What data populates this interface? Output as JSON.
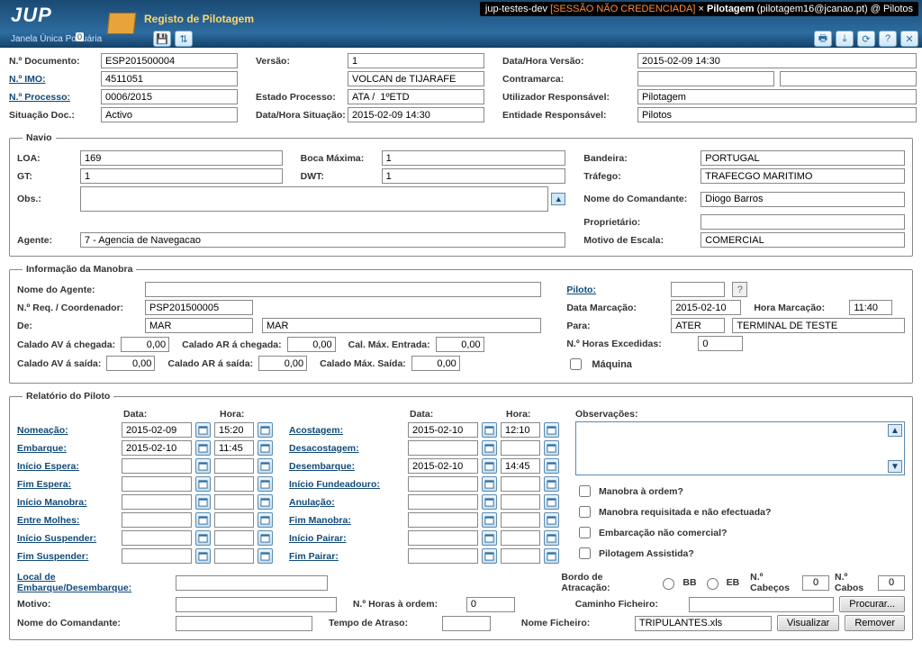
{
  "app": {
    "logo_text": "JUP",
    "subtitle": "Janela Única Portuária",
    "badge": "0",
    "module_title": "Registo de Pilotagem",
    "envbar_left": "jup-testes-dev",
    "envbar_sess": "[SESSÃO NÃO CREDENCIADA]",
    "envbar_module": "Pilotagem",
    "envbar_user": "(pilotagem16@jcanao.pt) @ Pilotos"
  },
  "header": {
    "n_documento_lbl": "N.º Documento:",
    "n_documento": "ESP201500004",
    "n_imo_lbl": "N.º IMO:",
    "n_imo": "4511051",
    "n_processo_lbl": "N.º Processo:",
    "n_processo": "0006/2015",
    "situacao_lbl": "Situação Doc.:",
    "situacao": "Activo",
    "versao_lbl": "Versão:",
    "versao": "1",
    "navio_nome": "VOLCAN de TIJARAFE",
    "estado_lbl": "Estado Processo:",
    "estado": "ATA /  1ºETD",
    "dh_sit_lbl": "Data/Hora Situação:",
    "dh_sit": "2015-02-09 14:30",
    "dh_ver_lbl": "Data/Hora Versão:",
    "dh_ver": "2015-02-09 14:30",
    "contramarca_lbl": "Contramarca:",
    "contramarca": "",
    "util_lbl": "Utilizador Responsável:",
    "util": "Pilotagem",
    "ent_lbl": "Entidade Responsável:",
    "ent": "Pilotos"
  },
  "navio": {
    "legend": "Navio",
    "loa_lbl": "LOA:",
    "loa": "169",
    "boca_lbl": "Boca Máxima:",
    "boca": "1",
    "gt_lbl": "GT:",
    "gt": "1",
    "dwt_lbl": "DWT:",
    "dwt": "1",
    "obs_lbl": "Obs.:",
    "obs": "",
    "agente_lbl": "Agente:",
    "agente": "7 - Agencia de Navegacao",
    "bandeira_lbl": "Bandeira:",
    "bandeira": "PORTUGAL",
    "trafego_lbl": "Tráfego:",
    "trafego": "TRAFECGO MARITIMO",
    "comandante_lbl": "Nome do Comandante:",
    "comandante": "Diogo Barros",
    "proprietario_lbl": "Proprietário:",
    "proprietario": "",
    "motivo_lbl": "Motivo de Escala:",
    "motivo": "COMERCIAL"
  },
  "manobra": {
    "legend": "Informação da Manobra",
    "nome_ag_lbl": "Nome do Agente:",
    "nome_ag": "",
    "nreq_lbl": "N.º Req. / Coordenador:",
    "nreq": "PSP201500005",
    "de_lbl": "De:",
    "de1": "MAR",
    "de2": "MAR",
    "piloto_lbl": "Piloto:",
    "dmarc_lbl": "Data Marcação:",
    "dmarc": "2015-02-10",
    "hmarc_lbl": "Hora Marcação:",
    "hmarc": "11:40",
    "para_lbl": "Para:",
    "para1": "ATER",
    "para2": "TERMINAL DE TESTE",
    "cav_cheg_lbl": "Calado AV á chegada:",
    "cav_cheg": "0,00",
    "car_cheg_lbl": "Calado AR á chegada:",
    "car_cheg": "0,00",
    "cmax_ent_lbl": "Cal. Máx. Entrada:",
    "cmax_ent": "0,00",
    "nh_exc_lbl": "N.º Horas Excedidas:",
    "nh_exc": "0",
    "cav_sai_lbl": "Calado AV á saída:",
    "cav_sai": "0,00",
    "car_sai_lbl": "Calado AR á saída:",
    "car_sai": "0,00",
    "cmax_sai_lbl": "Calado Máx. Saída:",
    "cmax_sai": "0,00",
    "maquina_lbl": "Máquina"
  },
  "relatorio": {
    "legend": "Relatório do Piloto",
    "data_hdr": "Data:",
    "hora_hdr": "Hora:",
    "nomeacao": "Nomeação:",
    "nomeacao_d": "2015-02-09",
    "nomeacao_h": "15:20",
    "embarque": "Embarque:",
    "embarque_d": "2015-02-10",
    "embarque_h": "11:45",
    "ini_espera": "Início Espera:",
    "fim_espera": "Fim Espera:",
    "ini_manobra": "Início Manobra:",
    "entre_molhes": "Entre Molhes:",
    "ini_suspender": "Início Suspender:",
    "fim_suspender": "Fim Suspender:",
    "acostagem": "Acostagem:",
    "acostagem_d": "2015-02-10",
    "acostagem_h": "12:10",
    "desacostagem": "Desacostagem:",
    "desembarque": "Desembarque:",
    "desembarque_d": "2015-02-10",
    "desembarque_h": "14:45",
    "ini_fund": "Início Fundeadouro:",
    "anulacao": "Anulação:",
    "fim_manobra": "Fim Manobra:",
    "ini_pairar": "Início Pairar:",
    "fim_pairar": "Fim Pairar:",
    "obs_lbl": "Observações:",
    "man_ordem": "Manobra à ordem?",
    "man_req": "Manobra requisitada e não efectuada?",
    "emb_ncom": "Embarcação não comercial?",
    "pil_assist": "Pilotagem Assistida?",
    "local_emb": "Local de Embarque/Desembarque:",
    "motivo": "Motivo:",
    "nome_com": "Nome do Comandante:",
    "nh_ordem": "N.º Horas à ordem:",
    "nh_ordem_v": "0",
    "tempo_atraso": "Tempo de Atraso:",
    "bordo_lbl": "Bordo de Atracação:",
    "bb": "BB",
    "eb": "EB",
    "ncabecos": "N.º Cabeços",
    "ncabecos_v": "0",
    "ncabos": "N.º Cabos",
    "ncabos_v": "0",
    "caminho": "Caminho Ficheiro:",
    "nome_fich": "Nome Ficheiro:",
    "nome_fich_v": "TRIPULANTES.xls",
    "btn_procurar": "Procurar...",
    "btn_visualizar": "Visualizar",
    "btn_remover": "Remover"
  }
}
